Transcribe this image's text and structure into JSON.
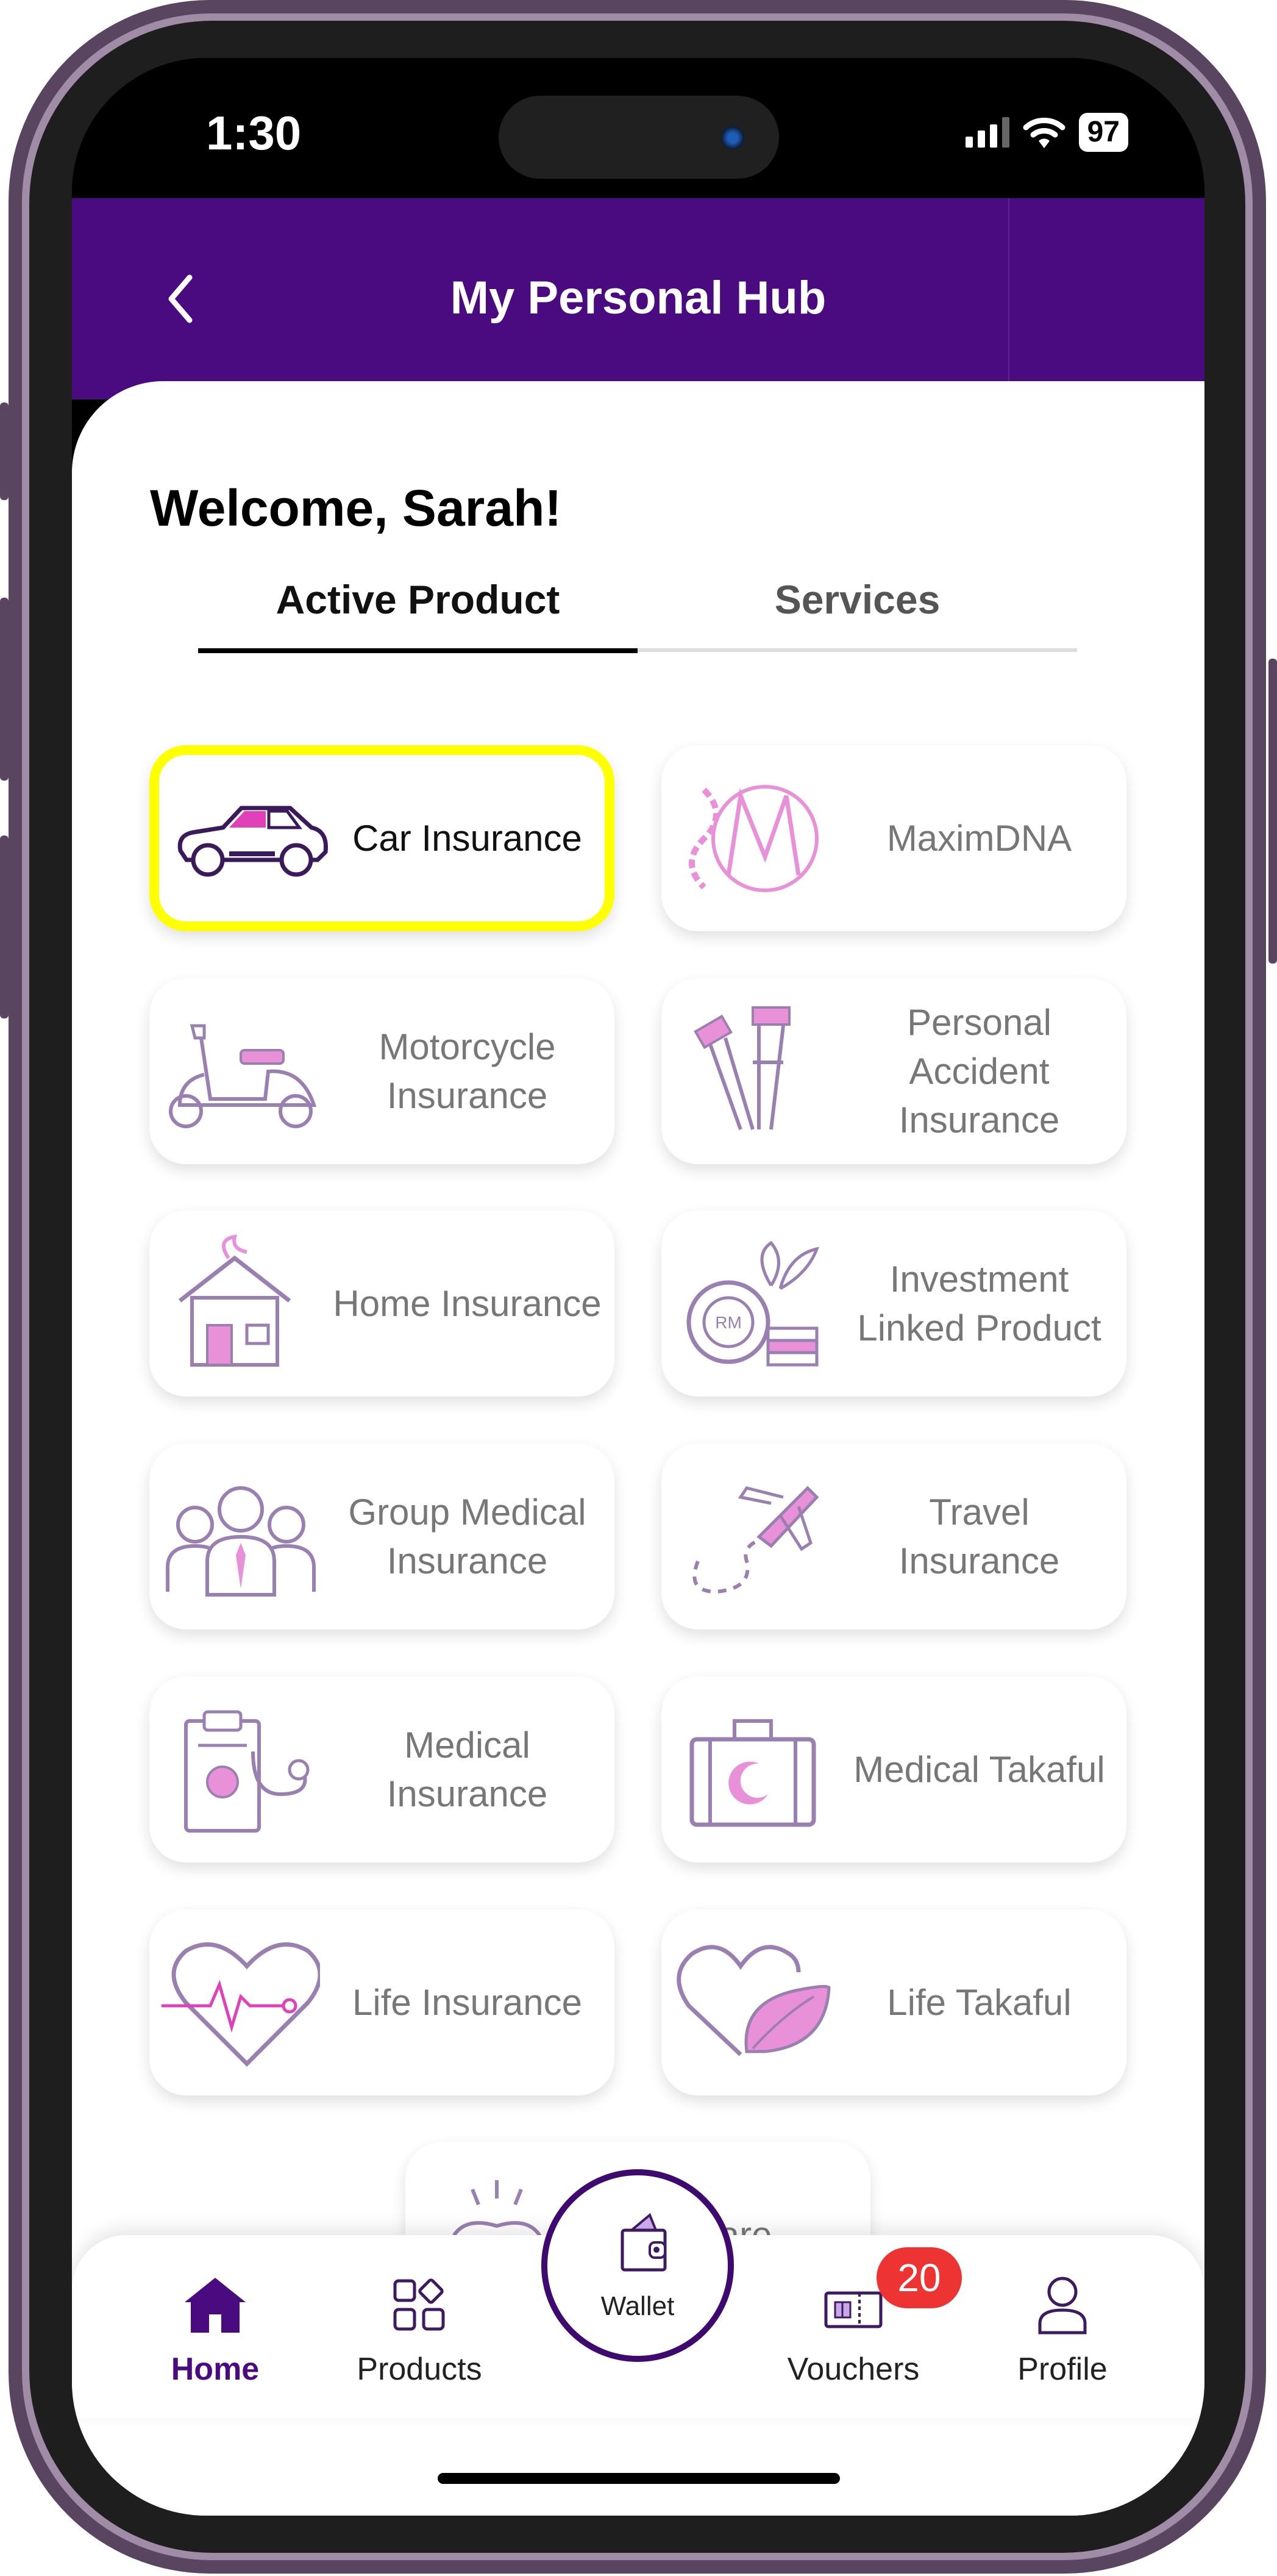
{
  "status_bar": {
    "time": "1:30",
    "battery": "97"
  },
  "header": {
    "title": "My Personal Hub",
    "back_icon": "chevron-left-icon"
  },
  "welcome": "Welcome, Sarah!",
  "tabs": [
    {
      "label": "Active Product",
      "active": true
    },
    {
      "label": "Services",
      "active": false
    }
  ],
  "products": [
    {
      "label": "Car Insurance",
      "icon": "car-icon",
      "highlighted": true
    },
    {
      "label": "MaximDNA",
      "icon": "dna-icon",
      "highlighted": false
    },
    {
      "label": "Motorcycle Insurance",
      "icon": "scooter-icon",
      "highlighted": false
    },
    {
      "label": "Personal Accident Insurance",
      "icon": "crutches-icon",
      "highlighted": false
    },
    {
      "label": "Home Insurance",
      "icon": "house-fire-icon",
      "highlighted": false
    },
    {
      "label": "Investment Linked Product",
      "icon": "coins-plant-icon",
      "highlighted": false
    },
    {
      "label": "Group Medical Insurance",
      "icon": "group-people-icon",
      "highlighted": false
    },
    {
      "label": "Travel Insurance",
      "icon": "airplane-icon",
      "highlighted": false
    },
    {
      "label": "Medical Insurance",
      "icon": "clipboard-stethoscope-icon",
      "highlighted": false
    },
    {
      "label": "Medical Takaful",
      "icon": "briefcase-moon-icon",
      "highlighted": false
    },
    {
      "label": "Life Insurance",
      "icon": "heart-pulse-icon",
      "highlighted": false
    },
    {
      "label": "Life Takaful",
      "icon": "heart-leaf-icon",
      "highlighted": false
    },
    {
      "label": "l Care",
      "icon": "tooth-icon",
      "highlighted": false
    }
  ],
  "bottom_nav": {
    "items": [
      {
        "label": "Home",
        "icon": "home-icon",
        "active": true
      },
      {
        "label": "Products",
        "icon": "grid-icon",
        "active": false
      },
      {
        "label": "Vouchers",
        "icon": "voucher-icon",
        "active": false
      },
      {
        "label": "Profile",
        "icon": "user-icon",
        "active": false
      }
    ],
    "wallet_label": "Wallet",
    "vouchers_badge": "20"
  },
  "colors": {
    "primary": "#4a0a80",
    "accent_pink": "#e080d0",
    "highlight": "#ffff00",
    "badge": "#e33333"
  }
}
